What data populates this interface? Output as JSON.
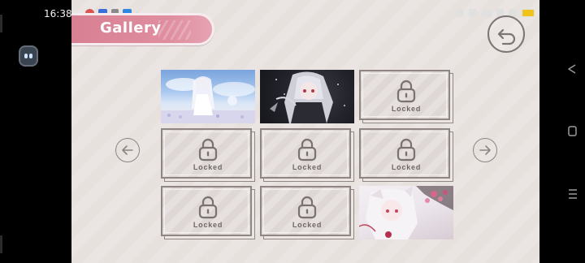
{
  "status_bar": {
    "time": "16:38"
  },
  "header": {
    "title": "Gallery"
  },
  "navigation": {
    "back_icon": "undo-arrow-icon",
    "prev_icon": "arrow-left-icon",
    "next_icon": "arrow-right-icon"
  },
  "gallery": {
    "tiles": [
      {
        "state": "unlocked",
        "label": ""
      },
      {
        "state": "unlocked",
        "label": ""
      },
      {
        "state": "locked",
        "label": "Locked"
      },
      {
        "state": "locked",
        "label": "Locked"
      },
      {
        "state": "locked",
        "label": "Locked"
      },
      {
        "state": "locked",
        "label": "Locked"
      },
      {
        "state": "locked",
        "label": "Locked"
      },
      {
        "state": "locked",
        "label": "Locked"
      },
      {
        "state": "unlocked",
        "label": ""
      }
    ]
  },
  "colors": {
    "banner": "#d87f93",
    "background": "#eae4e1",
    "frame": "#8f8684"
  }
}
